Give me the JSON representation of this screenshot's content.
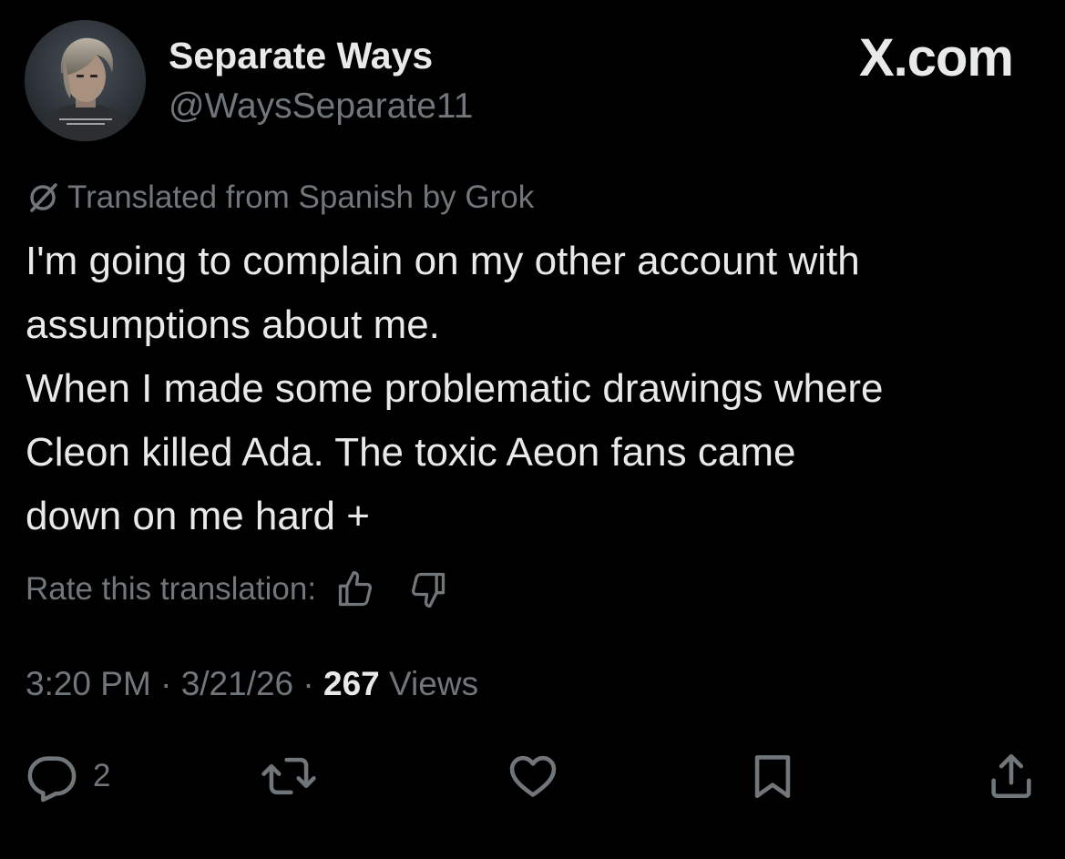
{
  "author": {
    "display_name": "Separate Ways",
    "handle": "@WaysSeparate11",
    "avatar_icon": "profile-photo"
  },
  "watermark": "X.com",
  "translation": {
    "notice": "Translated from Spanish by Grok",
    "notice_icon": "grok-icon",
    "rate_label": "Rate this translation:",
    "rate_up_icon": "thumbs-up-icon",
    "rate_down_icon": "thumbs-down-icon"
  },
  "tweet": {
    "lines": [
      "I'm going to complain on my other account with",
      "assumptions about me.",
      "When I made some problematic drawings where",
      "Cleon killed Ada. The toxic Aeon fans came",
      "down on me hard +"
    ]
  },
  "meta": {
    "time": "3:20 PM",
    "date": "3/21/26",
    "views_count": "267",
    "views_label": "Views",
    "separator": "·"
  },
  "actions": {
    "reply_count": "2",
    "reply_icon": "reply-icon",
    "repost_icon": "repost-icon",
    "like_icon": "heart-icon",
    "bookmark_icon": "bookmark-icon",
    "share_icon": "share-icon"
  },
  "colors": {
    "background": "#000000",
    "primary_text": "#e7e9ea",
    "secondary_text": "#71767b"
  }
}
